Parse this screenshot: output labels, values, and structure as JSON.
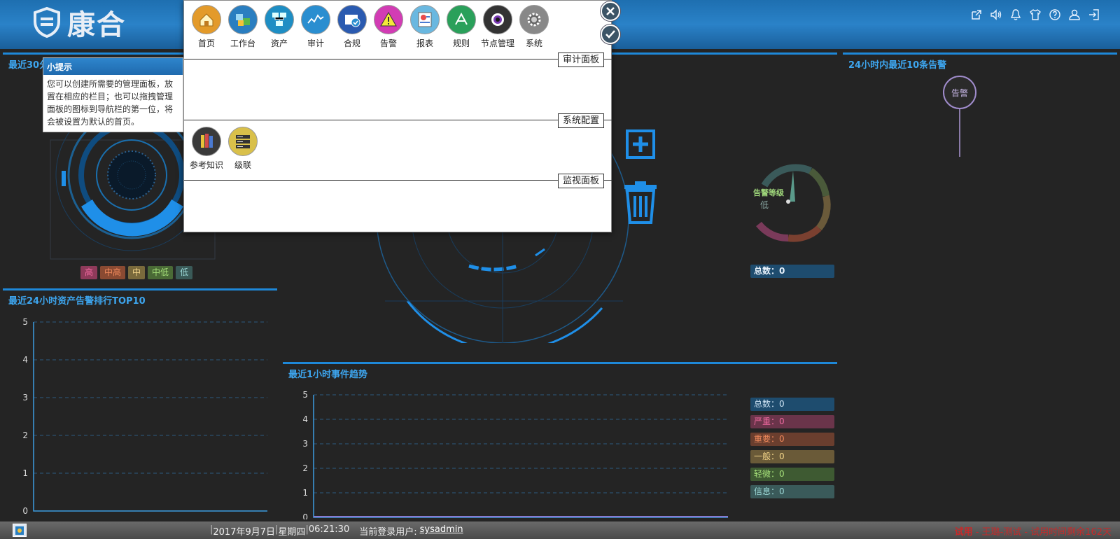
{
  "header": {
    "logo_text": "康合",
    "icons": [
      "external-link-icon",
      "volume-icon",
      "bell-icon",
      "shirt-icon",
      "help-icon",
      "user-icon",
      "logout-icon"
    ]
  },
  "left_top": {
    "title": "最近30分",
    "legend": [
      {
        "label": "高",
        "color": "#8e3a5a"
      },
      {
        "label": "中高",
        "color": "#8a4a32"
      },
      {
        "label": "中",
        "color": "#7a6a3c"
      },
      {
        "label": "中低",
        "color": "#4a6a36"
      },
      {
        "label": "低",
        "color": "#3a5a58"
      }
    ]
  },
  "left_bottom": {
    "title": "最近24小时资产告警排行TOP10",
    "chart_data": {
      "type": "bar",
      "categories": [],
      "values": [],
      "ylim": [
        0,
        5
      ],
      "yticks": [
        0,
        1,
        2,
        3,
        4,
        5
      ],
      "grid": true
    }
  },
  "center_bottom": {
    "title": "最近1小时事件趋势",
    "chart_data": {
      "type": "line",
      "x": [],
      "series": [],
      "ylim": [
        0,
        5
      ],
      "yticks": [
        0,
        1,
        2,
        3,
        4,
        5
      ],
      "grid": true
    },
    "stats": [
      {
        "label": "总数：0",
        "bg": "#1e4c6e",
        "fg": "#cfe4f5"
      },
      {
        "label": "严重：0",
        "bg": "#6a344a",
        "fg": "#f06aa0"
      },
      {
        "label": "重要：0",
        "bg": "#6a3e2e",
        "fg": "#f08a5c"
      },
      {
        "label": "一般：0",
        "bg": "#6a5a38",
        "fg": "#f4d68a"
      },
      {
        "label": "轻微：0",
        "bg": "#3e5a32",
        "fg": "#a6e07a"
      },
      {
        "label": "信息：0",
        "bg": "#3a5a5a",
        "fg": "#9ad6d4"
      }
    ]
  },
  "right_top": {
    "title": "24小时内最近10条告警",
    "node_label": "告警",
    "gauge_title": "告警等级",
    "gauge_value": "低",
    "total": "总数：0"
  },
  "popup": {
    "nav": [
      {
        "name": "home",
        "label": "首页",
        "color": "#e39a2a",
        "icon": "home-icon"
      },
      {
        "name": "workbench",
        "label": "工作台",
        "color": "#2a7ec0",
        "icon": "workbench-icon"
      },
      {
        "name": "assets",
        "label": "资产",
        "color": "#1e8ec4",
        "icon": "network-icon"
      },
      {
        "name": "audit",
        "label": "审计",
        "color": "#2a8ed0",
        "icon": "chart-line-icon"
      },
      {
        "name": "compliance",
        "label": "合规",
        "color": "#2a5ab0",
        "icon": "compliance-icon"
      },
      {
        "name": "alarm",
        "label": "告警",
        "color": "#d23cb4",
        "icon": "warning-icon"
      },
      {
        "name": "report",
        "label": "报表",
        "color": "#6ab8e0",
        "icon": "report-icon"
      },
      {
        "name": "rules",
        "label": "规则",
        "color": "#2aa05a",
        "icon": "rules-icon"
      },
      {
        "name": "node",
        "label": "节点管理",
        "color": "#333",
        "icon": "camera-icon"
      },
      {
        "name": "system",
        "label": "系统",
        "color": "#888",
        "icon": "gear-icon"
      }
    ],
    "sections": [
      "审计面板",
      "系统配置",
      "监视面板"
    ],
    "config_items": [
      {
        "name": "knowledge",
        "label": "参考知识",
        "icon": "books-icon"
      },
      {
        "name": "cascade",
        "label": "级联",
        "icon": "server-rack-icon"
      }
    ]
  },
  "tip": {
    "title": "小提示",
    "body": "您可以创建所需要的管理面板，放置在相应的栏目；也可以拖拽管理面板的图标到导航栏的第一位，将会被设置为默认的首页。"
  },
  "statusbar": {
    "date": "2017年9月7日",
    "weekday": "星期四",
    "time": "06:21:30",
    "user_label": "当前登录用户:",
    "user": "sysadmin",
    "trial_prefix": "试用",
    "trial_text": " - 王璐-测试 - 试用时间剩余162天"
  }
}
